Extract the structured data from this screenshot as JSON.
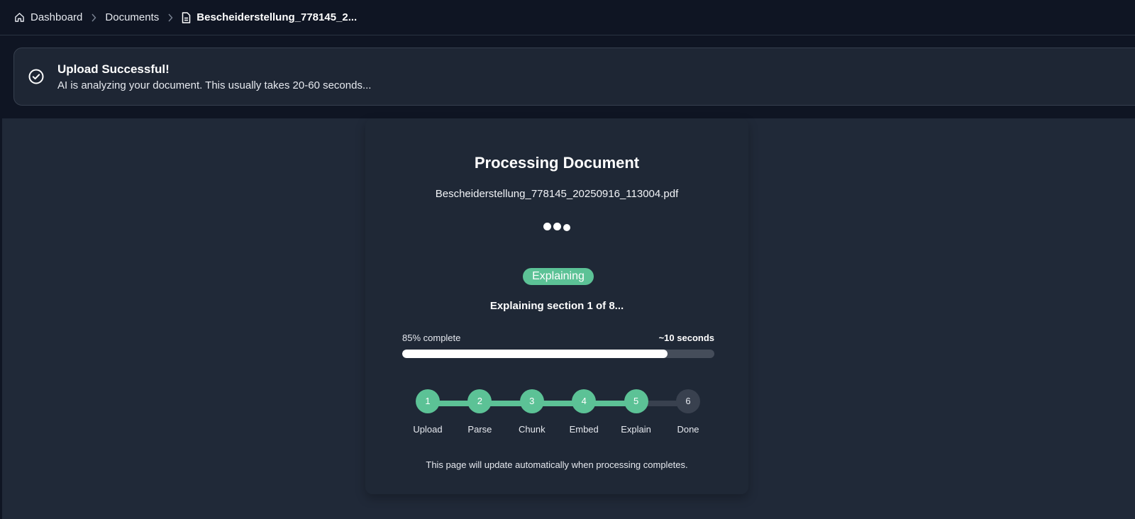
{
  "breadcrumb": {
    "items": [
      "Dashboard",
      "Documents"
    ],
    "current": "Bescheiderstellung_778145_2..."
  },
  "alert": {
    "title": "Upload Successful!",
    "message": "AI is analyzing your document. This usually takes 20-60 seconds..."
  },
  "processing": {
    "title": "Processing Document",
    "filename": "Bescheiderstellung_778145_20250916_113004.pdf",
    "stage_badge": "Explaining",
    "status_text": "Explaining section 1 of 8...",
    "progress_percent": 85,
    "progress_label": "85% complete",
    "eta_label": "~10 seconds",
    "steps": [
      {
        "number": "1",
        "label": "Upload",
        "state": "done"
      },
      {
        "number": "2",
        "label": "Parse",
        "state": "done"
      },
      {
        "number": "3",
        "label": "Chunk",
        "state": "done"
      },
      {
        "number": "4",
        "label": "Embed",
        "state": "done"
      },
      {
        "number": "5",
        "label": "Explain",
        "state": "done"
      },
      {
        "number": "6",
        "label": "Done",
        "state": "todo"
      }
    ],
    "footer_note": "This page will update automatically when processing completes."
  },
  "colors": {
    "accent_green": "#5cc296",
    "background": "#0f1523",
    "panel": "#202938"
  },
  "icons": {
    "home": "home-icon",
    "file": "file-icon",
    "chevron": "chevron-right-icon",
    "success": "check-circle-icon"
  }
}
